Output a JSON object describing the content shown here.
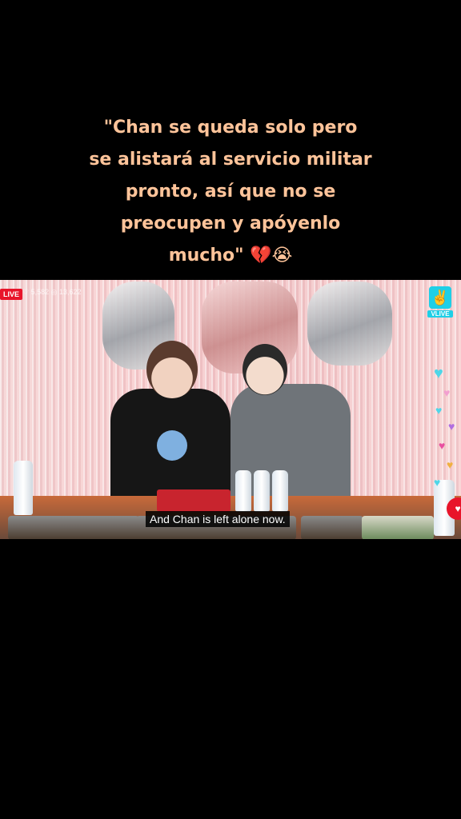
{
  "caption": {
    "lines": [
      "\"Chan se queda solo pero",
      "se alistará al servicio militar",
      "pronto, así que no se",
      "preocupen y apóyenlo",
      "mucho\" 💔😭"
    ]
  },
  "video": {
    "live_label": "LIVE",
    "counts_text": "♡ 5,582  ◎ 13,622",
    "brand_label": "VLIVE",
    "brand_glyph": "✌",
    "subtitle": "And Chan is left alone now."
  },
  "colors": {
    "caption": "#ffc49a",
    "live": "#e8142a",
    "vlive": "#1ecfe6"
  },
  "icons": {
    "live": "live-badge",
    "brand": "vlive-logo-icon",
    "reactions": "heart-icon",
    "action": "heart-button-icon"
  }
}
